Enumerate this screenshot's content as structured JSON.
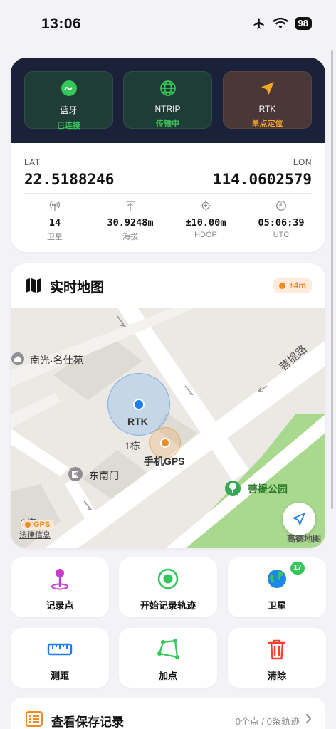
{
  "status_bar": {
    "time": "13:06",
    "battery": "98"
  },
  "connections": [
    {
      "title": "蓝牙",
      "status": "已连接",
      "status_color": "#34c759"
    },
    {
      "title": "NTRIP",
      "status": "传输中",
      "status_color": "#34c759"
    },
    {
      "title": "RTK",
      "status": "单点定位",
      "status_color": "#f5a623"
    }
  ],
  "position": {
    "lat_label": "LAT",
    "lat": "22.5188246",
    "lon_label": "LON",
    "lon": "114.0602579"
  },
  "stats": [
    {
      "value": "14",
      "label": "卫星"
    },
    {
      "value": "30.9248m",
      "label": "海拔"
    },
    {
      "value": "±10.00m",
      "label": "HDOP"
    },
    {
      "value": "05:06:39",
      "label": "UTC"
    }
  ],
  "map": {
    "title": "实时地图",
    "accuracy_badge": "±4m",
    "labels": {
      "poi_nanguang": "南光·名仕苑",
      "road_puti": "菩提路",
      "rtk_marker": "RTK",
      "building_1": "1栋",
      "phone_gps": "手机GPS",
      "gate_southeast": "东南门",
      "park_puti": "菩提公园",
      "building_2": "2栋",
      "legend_gps": "GPS",
      "legal_info": "法律信息",
      "provider": "高德地图"
    }
  },
  "actions": [
    {
      "label": "记录点"
    },
    {
      "label": "开始记录轨迹"
    },
    {
      "label": "卫星",
      "badge": "17"
    },
    {
      "label": "测距"
    },
    {
      "label": "加点"
    },
    {
      "label": "清除"
    }
  ],
  "records": {
    "title": "查看保存记录",
    "summary": "0个点 / 0条轨迹"
  },
  "colors": {
    "accent_blue": "#1e7cf0",
    "accent_orange": "#f08a24",
    "green": "#34c759",
    "dark_panel": "#1a2138"
  }
}
